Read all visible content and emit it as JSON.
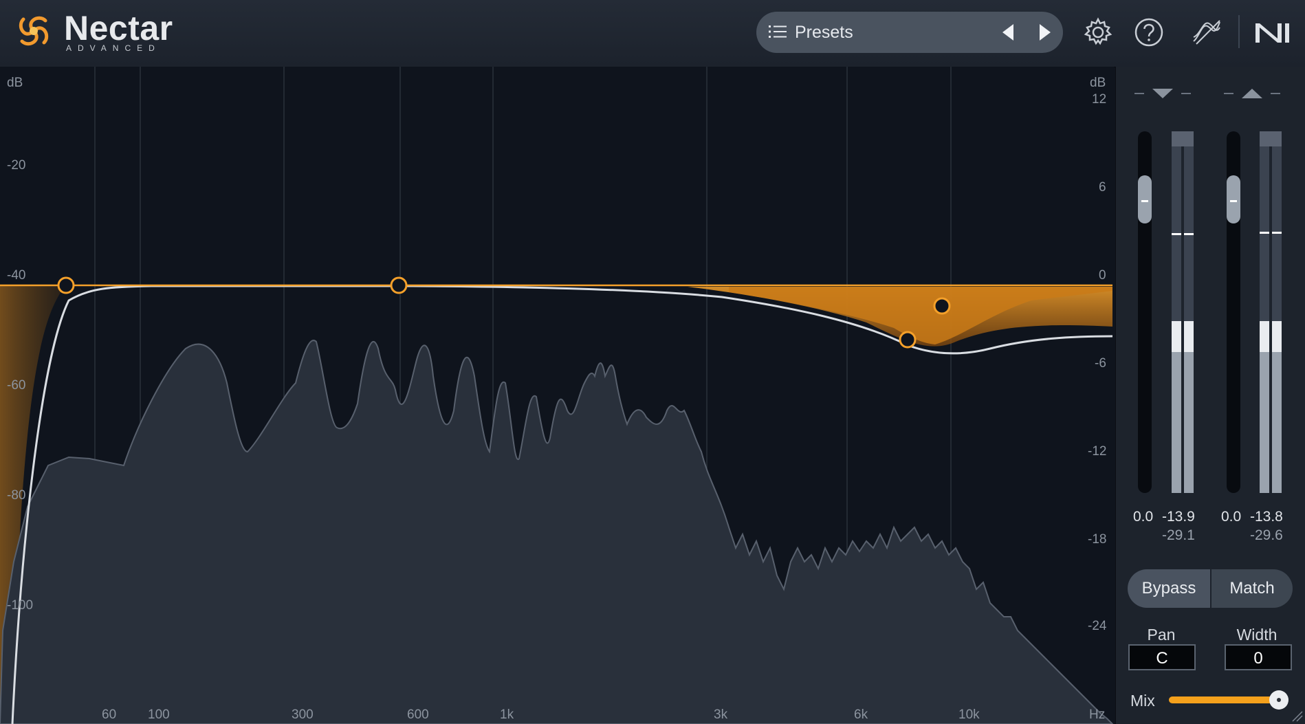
{
  "app": {
    "name": "Nectar",
    "edition": "ADVANCED"
  },
  "presets": {
    "label": "Presets"
  },
  "icons": {
    "logo": "nectar-logo-icon",
    "menu": "list-menu-icon",
    "prev": "triangle-left-icon",
    "next": "triangle-right-icon",
    "settings": "gear-icon",
    "help": "question-icon",
    "signal": "signal-path-icon",
    "brand": "native-instruments-logo-icon"
  },
  "graph": {
    "left_axis_unit": "dB",
    "right_axis_unit": "dB",
    "left_ticks": [
      "-20",
      "-40",
      "-60",
      "-80",
      "-100"
    ],
    "right_ticks": [
      "12",
      "6",
      "0",
      "-6",
      "-12",
      "-18",
      "-24"
    ],
    "freq_ticks": [
      "60",
      "100",
      "300",
      "600",
      "1k",
      "3k",
      "6k",
      "10k"
    ],
    "freq_unit": "Hz",
    "nodes": [
      "node-low-cut",
      "node-low-mid",
      "node-high-mid",
      "node-high"
    ]
  },
  "meters": {
    "input": {
      "gain": "0.0",
      "peak": "-13.9",
      "rms": "-29.1"
    },
    "output": {
      "gain": "0.0",
      "peak": "-13.8",
      "rms": "-29.6"
    }
  },
  "controls": {
    "bypass": "Bypass",
    "match": "Match",
    "pan_label": "Pan",
    "pan_value": "C",
    "width_label": "Width",
    "width_value": "0",
    "mix_label": "Mix",
    "mix_level": 1.0
  },
  "colors": {
    "accent": "#f5a11c",
    "background": "#0f141d",
    "spectrum": "#2a313c"
  }
}
